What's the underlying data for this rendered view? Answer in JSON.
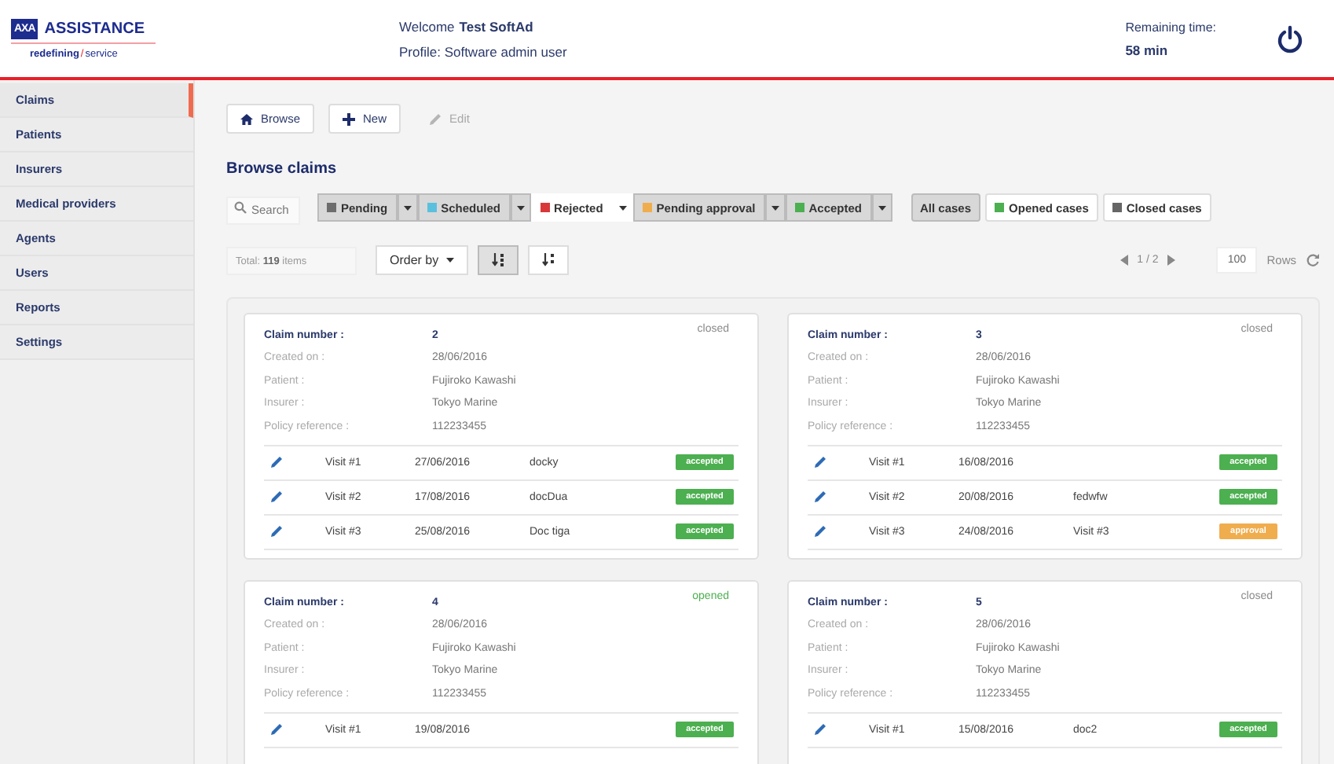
{
  "logo": {
    "mark": "AXA",
    "name": "ASSISTANCE",
    "tagline_left": "redefining",
    "tagline_sep": "/",
    "tagline_right": "service"
  },
  "user": {
    "welcome": "Welcome",
    "name": "Test SoftAd",
    "profile": "Profile: Software admin user"
  },
  "session": {
    "label": "Remaining time:",
    "value": "58 min"
  },
  "sidebar": {
    "items": [
      {
        "label": "Claims",
        "selected": true
      },
      {
        "label": "Patients",
        "selected": false
      },
      {
        "label": "Insurers",
        "selected": false
      },
      {
        "label": "Medical providers",
        "selected": false
      },
      {
        "label": "Agents",
        "selected": false
      },
      {
        "label": "Users",
        "selected": false
      },
      {
        "label": "Reports",
        "selected": false
      },
      {
        "label": "Settings",
        "selected": false
      }
    ]
  },
  "toolbar": {
    "buttons": [
      {
        "label": "Browse",
        "kind": "home",
        "disabled": false
      },
      {
        "label": "New",
        "kind": "plus",
        "disabled": false
      },
      {
        "label": "Edit",
        "kind": "pencil",
        "disabled": true
      }
    ]
  },
  "title": "Browse claims",
  "search": {
    "placeholder": "Search"
  },
  "status_filters": [
    {
      "label": "Pending",
      "color": "#6d6d6d",
      "selected": true
    },
    {
      "label": "Scheduled",
      "color": "#5bc0de",
      "selected": true
    },
    {
      "label": "Rejected",
      "color": "#d9383a",
      "selected": false
    },
    {
      "label": "Pending approval",
      "color": "#f0ad4e",
      "selected": true
    },
    {
      "label": "Accepted",
      "color": "#4caf50",
      "selected": true
    }
  ],
  "case_filters": [
    {
      "label": "All cases",
      "selected": true
    },
    {
      "label": "Opened cases",
      "color": "#4caf50",
      "selected": false
    },
    {
      "label": "Closed cases",
      "color": "#666666",
      "selected": false
    }
  ],
  "total": {
    "label": "Total:",
    "count": "119",
    "unit": "items"
  },
  "order_by": {
    "label": "Order by"
  },
  "sort_buttons": [
    {
      "kind": "descending",
      "selected": true
    },
    {
      "kind": "ascending",
      "selected": false
    }
  ],
  "pagination": {
    "page": "1 / 2",
    "rows": "100",
    "rows_label": "Rows"
  },
  "claims": [
    {
      "number_label": "Claim number :",
      "number": "2",
      "status": "closed",
      "color": "#8a8a8a",
      "fields": [
        {
          "label": "Created on :",
          "value": "28/06/2016"
        },
        {
          "label": "Patient :",
          "value": "Fujiroko Kawashi"
        },
        {
          "label": "Insurer :",
          "value": "Tokyo Marine"
        },
        {
          "label": "Policy reference :",
          "value": "112233455"
        }
      ],
      "visits": [
        {
          "name": "Visit #1",
          "date": "27/06/2016",
          "doctor": "docky",
          "badge": "accepted",
          "color": "#4caf50"
        },
        {
          "name": "Visit #2",
          "date": "17/08/2016",
          "doctor": "docDua",
          "badge": "accepted",
          "color": "#4caf50"
        },
        {
          "name": "Visit #3",
          "date": "25/08/2016",
          "doctor": "Doc tiga",
          "badge": "accepted",
          "color": "#4caf50"
        }
      ]
    },
    {
      "number_label": "Claim number :",
      "number": "3",
      "status": "closed",
      "color": "#8a8a8a",
      "fields": [
        {
          "label": "Created on :",
          "value": "28/06/2016"
        },
        {
          "label": "Patient :",
          "value": "Fujiroko Kawashi"
        },
        {
          "label": "Insurer :",
          "value": "Tokyo Marine"
        },
        {
          "label": "Policy reference :",
          "value": "112233455"
        }
      ],
      "visits": [
        {
          "name": "Visit #1",
          "date": "16/08/2016",
          "badge": "accepted",
          "color": "#4caf50"
        },
        {
          "name": "Visit #2",
          "date": "20/08/2016",
          "doctor": "fedwfw",
          "badge": "accepted",
          "color": "#4caf50"
        },
        {
          "name": "Visit #3",
          "date": "24/08/2016",
          "doctor": "Visit #3",
          "badge": "approval",
          "color": "#f0ad4e"
        }
      ]
    },
    {
      "number_label": "Claim number :",
      "number": "4",
      "status": "opened",
      "color": "#4caf50",
      "fields": [
        {
          "label": "Created on :",
          "value": "28/06/2016"
        },
        {
          "label": "Patient :",
          "value": "Fujiroko Kawashi"
        },
        {
          "label": "Insurer :",
          "value": "Tokyo Marine"
        },
        {
          "label": "Policy reference :",
          "value": "112233455"
        }
      ],
      "visits": [
        {
          "name": "Visit #1",
          "date": "19/08/2016",
          "badge": "accepted",
          "color": "#4caf50"
        }
      ]
    },
    {
      "number_label": "Claim number :",
      "number": "5",
      "status": "closed",
      "color": "#8a8a8a",
      "fields": [
        {
          "label": "Created on :",
          "value": "28/06/2016"
        },
        {
          "label": "Patient :",
          "value": "Fujiroko Kawashi"
        },
        {
          "label": "Insurer :",
          "value": "Tokyo Marine"
        },
        {
          "label": "Policy reference :",
          "value": "112233455"
        }
      ],
      "visits": [
        {
          "name": "Visit #1",
          "date": "15/08/2016",
          "doctor": "doc2",
          "badge": "accepted",
          "color": "#4caf50"
        }
      ]
    }
  ]
}
